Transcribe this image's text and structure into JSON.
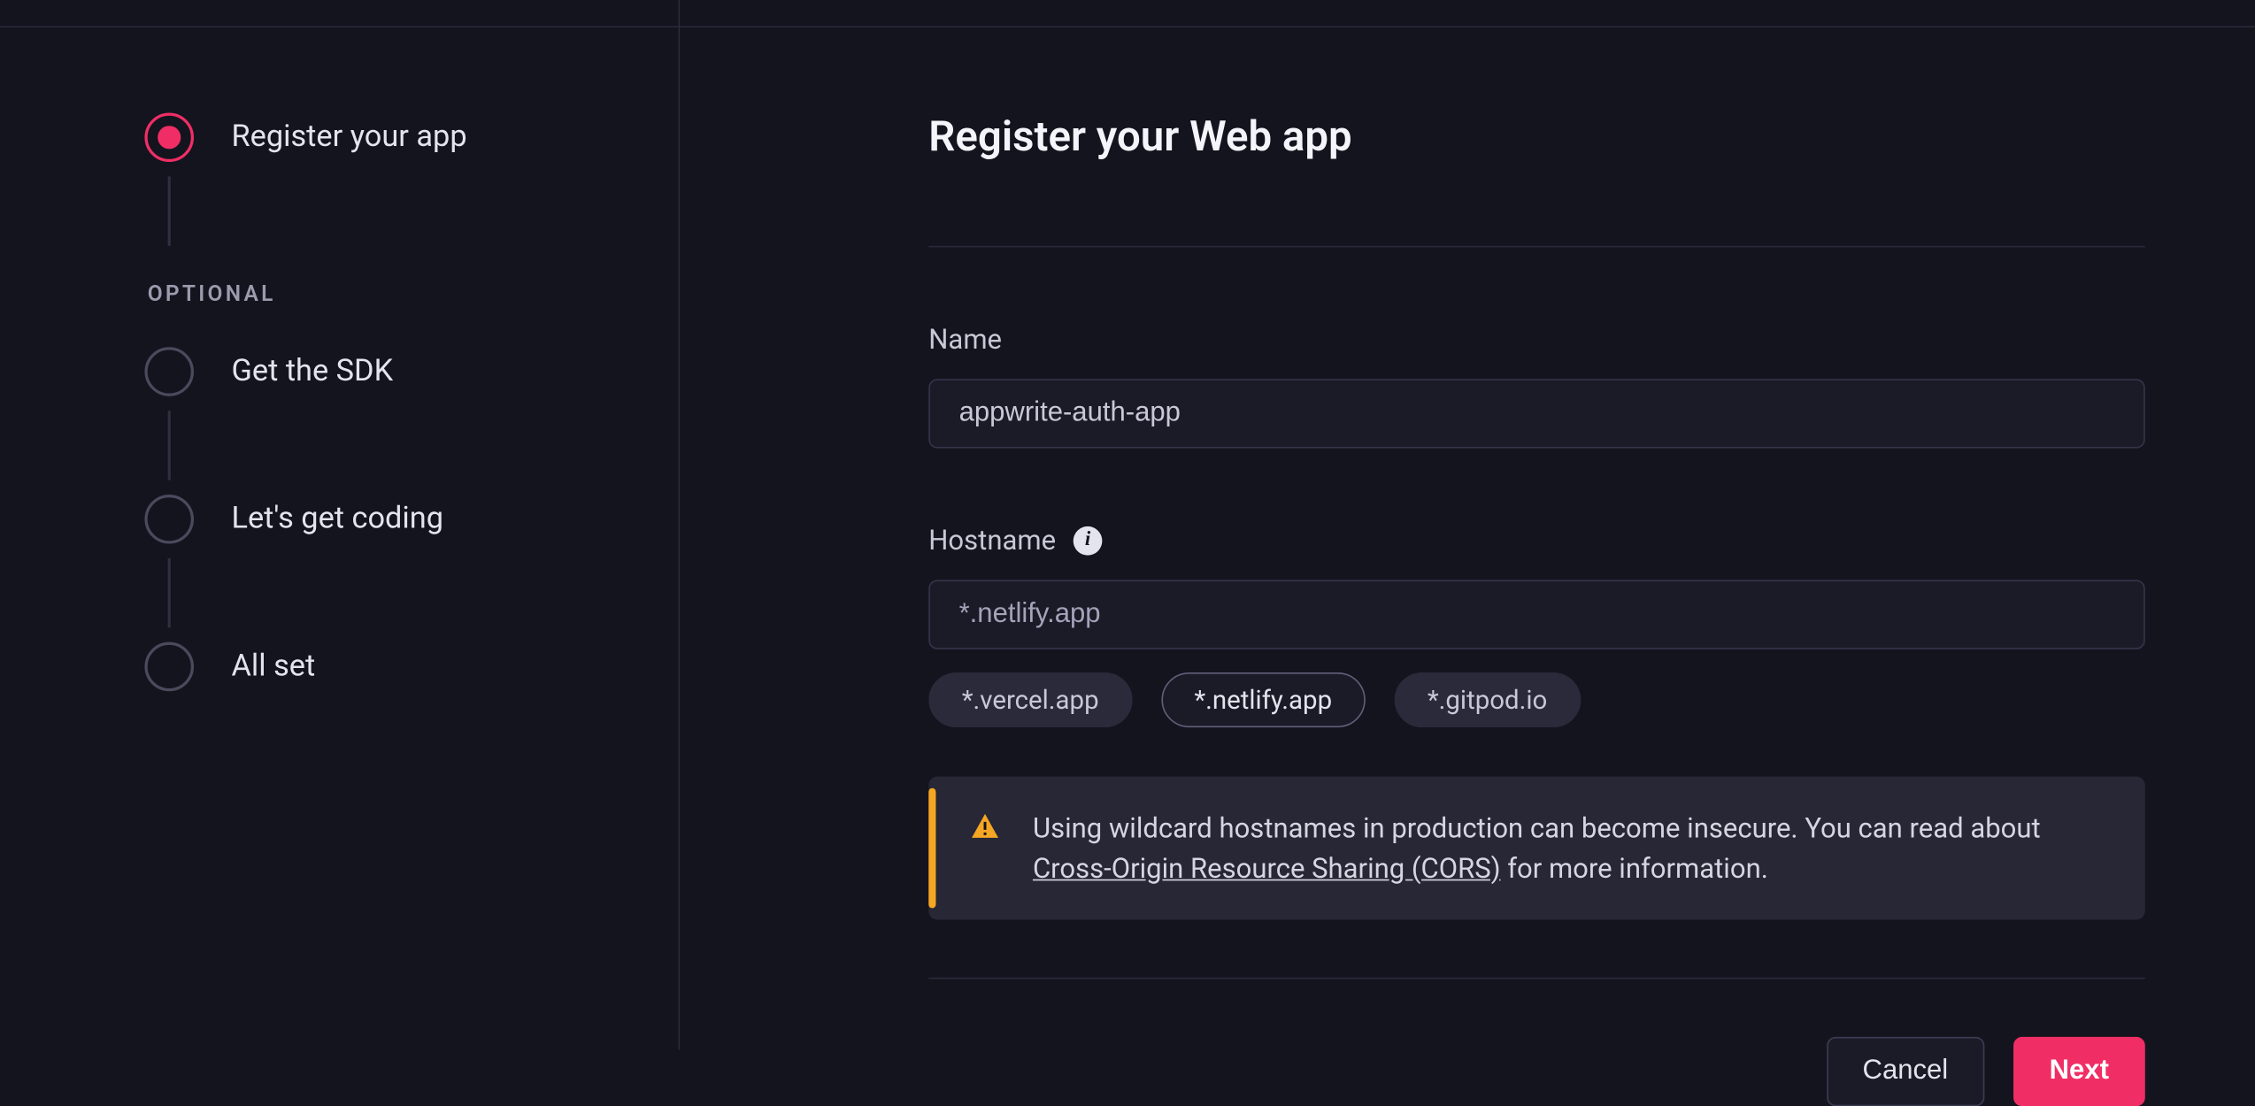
{
  "sidebar": {
    "optional_label": "OPTIONAL",
    "steps": [
      {
        "label": "Register your app",
        "state": "active"
      },
      {
        "label": "Get the SDK",
        "state": "pending"
      },
      {
        "label": "Let's get coding",
        "state": "pending"
      },
      {
        "label": "All set",
        "state": "pending"
      }
    ]
  },
  "main": {
    "title": "Register your Web app",
    "name_field": {
      "label": "Name",
      "value": "appwrite-auth-app"
    },
    "hostname_field": {
      "label": "Hostname",
      "value": "*.netlify.app",
      "chips": [
        {
          "label": "*.vercel.app",
          "selected": false
        },
        {
          "label": "*.netlify.app",
          "selected": true
        },
        {
          "label": "*.gitpod.io",
          "selected": false
        }
      ]
    },
    "alert": {
      "text_before_link": "Using wildcard hostnames in production can become insecure. You can read about ",
      "link_text": "Cross-Origin Resource Sharing (CORS)",
      "text_after_link": " for more information."
    },
    "buttons": {
      "cancel": "Cancel",
      "next": "Next"
    }
  }
}
